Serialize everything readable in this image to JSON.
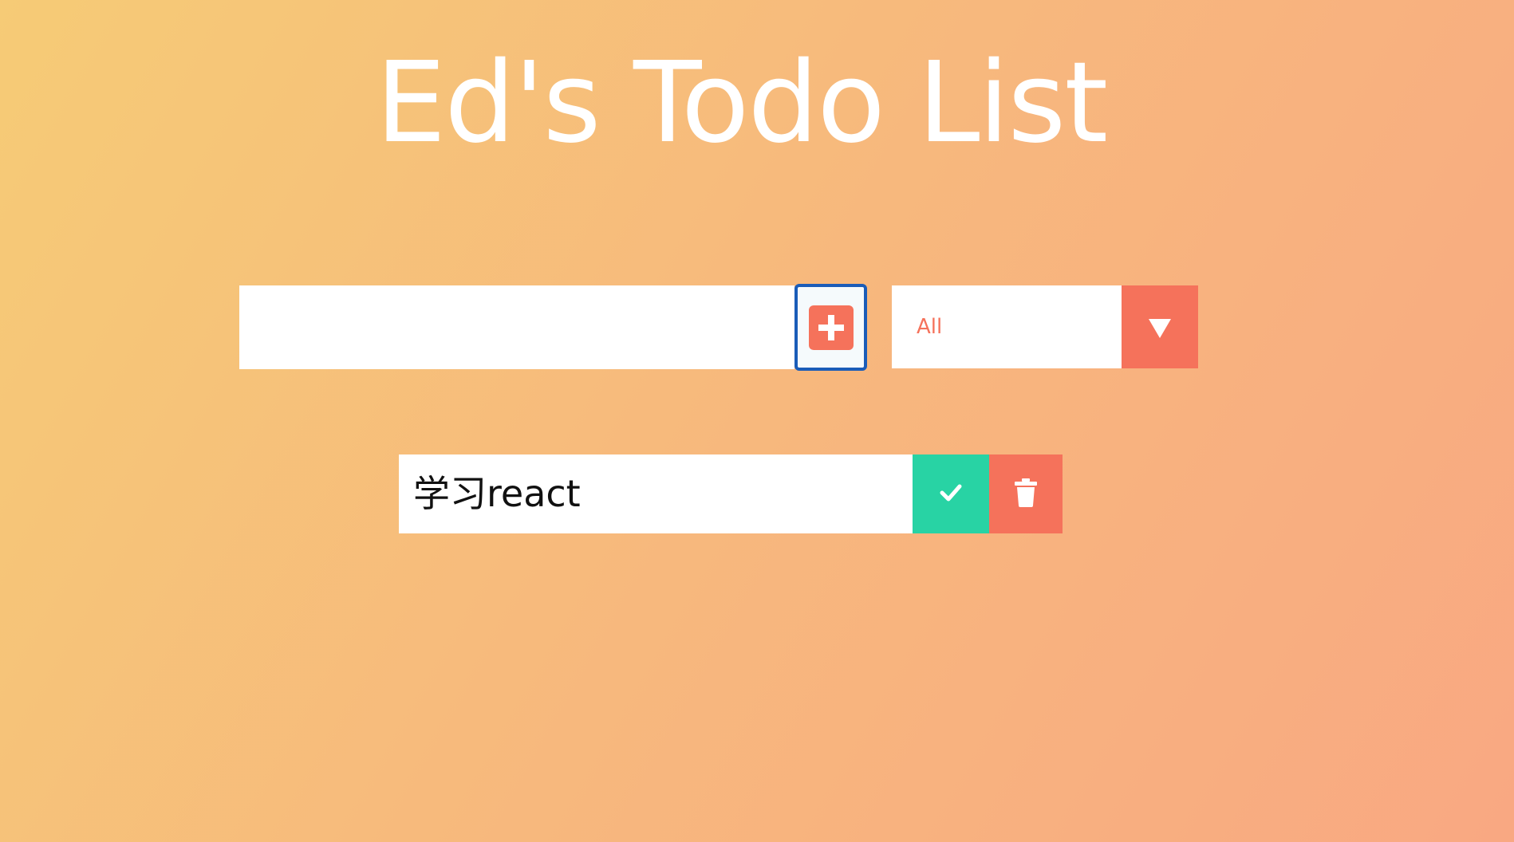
{
  "header": {
    "title": "Ed's Todo List"
  },
  "form": {
    "input_value": "",
    "add_icon": "plus-square-icon",
    "filter": {
      "selected": "All",
      "arrow_icon": "caret-down-icon"
    }
  },
  "todos": [
    {
      "text": "学习react",
      "complete_icon": "check-icon",
      "delete_icon": "trash-icon"
    }
  ],
  "colors": {
    "accent": "#f5725b",
    "complete": "#28d3a4",
    "focus_border": "#1a5cb8",
    "gradient_start": "#f6cb76",
    "gradient_end": "#f9a882"
  }
}
